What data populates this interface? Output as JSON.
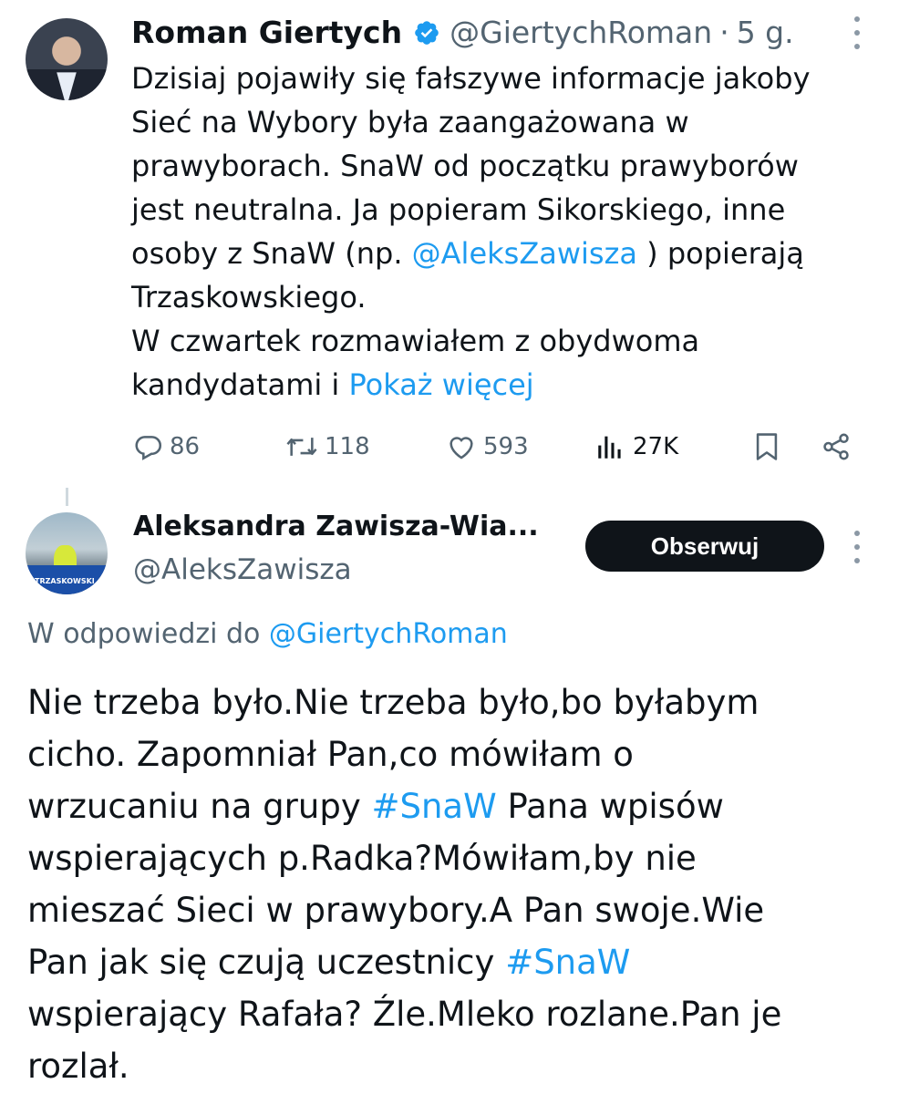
{
  "tweet1": {
    "author_name": "Roman Giertych",
    "author_handle": "@GiertychRoman",
    "separator": "·",
    "time": "5 g.",
    "text_lines": [
      [
        {
          "t": "Dzisiaj pojawiły się fałszywe informacje jakoby"
        }
      ],
      [
        {
          "t": "Sieć na Wybory była zaangażowana w"
        }
      ],
      [
        {
          "t": "prawyborach. SnaW od początku prawyborów"
        }
      ],
      [
        {
          "t": "jest neutralna. Ja popieram Sikorskiego, inne"
        }
      ],
      [
        {
          "t": "osoby z SnaW (np. "
        },
        {
          "t": "@AleksZawisza",
          "link": true
        },
        {
          "t": " ) popierają"
        }
      ],
      [
        {
          "t": "Trzaskowskiego."
        }
      ],
      [
        {
          "t": "W czwartek rozmawiałem z obydwoma"
        }
      ],
      [
        {
          "t": "kandydatami i "
        },
        {
          "t": "Pokaż więcej",
          "link": true
        }
      ]
    ],
    "stats": {
      "replies": "86",
      "retweets": "118",
      "likes": "593",
      "views": "27K"
    }
  },
  "tweet2": {
    "author_name": "Aleksandra Zawisza-Wia...",
    "author_handle": "@AleksZawisza",
    "follow_label": "Obserwuj",
    "reply_prefix": "W odpowiedzi do ",
    "reply_handle": "@GiertychRoman",
    "text_lines": [
      [
        {
          "t": "Nie trzeba było.Nie trzeba było,bo byłabym"
        }
      ],
      [
        {
          "t": "cicho. Zapomniał Pan,co mówiłam o"
        }
      ],
      [
        {
          "t": "wrzucaniu na grupy "
        },
        {
          "t": "#SnaW",
          "link": true
        },
        {
          "t": " Pana wpisów"
        }
      ],
      [
        {
          "t": "wspierających p.Radka?Mówiłam,by nie"
        }
      ],
      [
        {
          "t": "mieszać Sieci w prawybory.A Pan swoje.Wie"
        }
      ],
      [
        {
          "t": "Pan jak się czują uczestnicy "
        },
        {
          "t": "#SnaW",
          "link": true
        }
      ],
      [
        {
          "t": "wspierający Rafała? Źle.Mleko rozlane.Pan je"
        }
      ],
      [
        {
          "t": "rozlał."
        }
      ]
    ]
  },
  "colors": {
    "text": "#0f1419",
    "muted": "#536471",
    "link": "#1d9bf0",
    "verified": "#1d9bf0",
    "button_bg": "#0f1419"
  },
  "icons": [
    "verified-badge-icon",
    "more-icon",
    "reply-icon",
    "retweet-icon",
    "like-icon",
    "views-icon",
    "bookmark-icon",
    "share-icon"
  ]
}
